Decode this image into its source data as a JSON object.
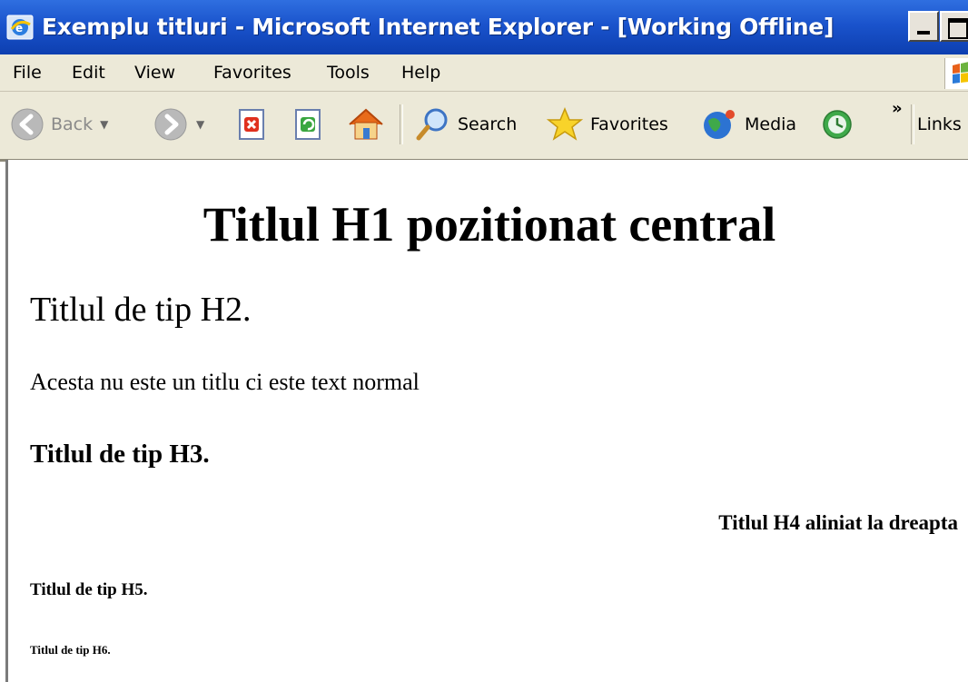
{
  "window": {
    "title": "Exemplu titluri - Microsoft Internet Explorer - [Working Offline]",
    "icons": [
      "ie-app-icon",
      "minimize-icon",
      "maximize-icon"
    ]
  },
  "menu": {
    "items": [
      "File",
      "Edit",
      "View",
      "Favorites",
      "Tools",
      "Help"
    ]
  },
  "toolbar": {
    "back_label": "Back",
    "search_label": "Search",
    "favorites_label": "Favorites",
    "media_label": "Media",
    "chevron_label": "»",
    "links_label": "Links"
  },
  "page": {
    "h1": "Titlul H1 pozitionat central",
    "h2": "Titlul de tip H2.",
    "paragraph": "Acesta nu este un titlu ci este text normal",
    "h3": "Titlul de tip H3.",
    "h4": "Titlul H4 aliniat la dreapta",
    "h5": "Titlul de tip H5.",
    "h6": "Titlul de tip H6."
  },
  "colors": {
    "titlebar": "#1a53cc",
    "chrome": "#ece9d8",
    "content_bg": "#ffffff"
  }
}
